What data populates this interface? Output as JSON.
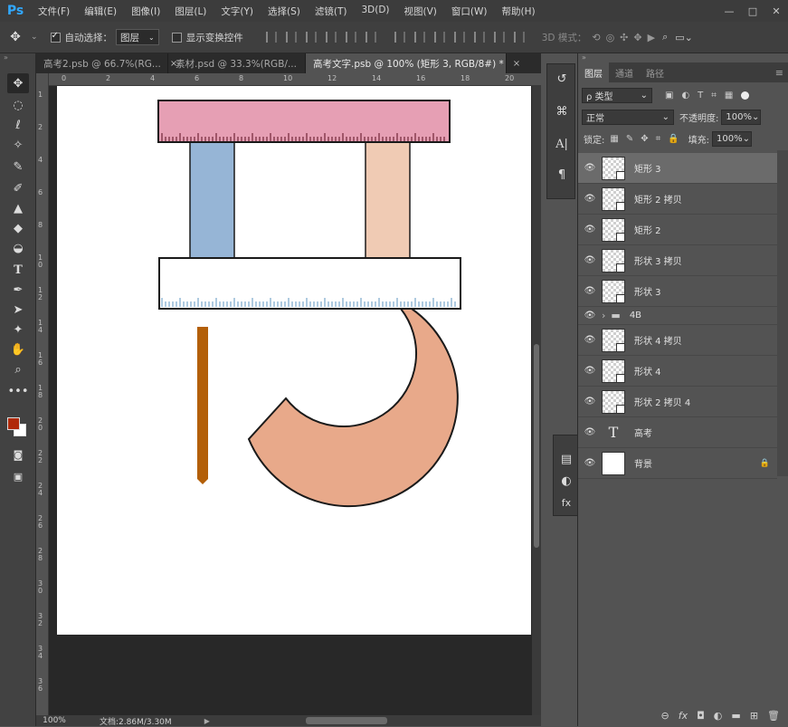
{
  "app": {
    "logo": "Ps"
  },
  "menu": [
    "文件(F)",
    "编辑(E)",
    "图像(I)",
    "图层(L)",
    "文字(Y)",
    "选择(S)",
    "滤镜(T)",
    "3D(D)",
    "视图(V)",
    "窗口(W)",
    "帮助(H)"
  ],
  "window_controls": {
    "minimize": "—",
    "maximize": "□",
    "close": "✕"
  },
  "options": {
    "auto_select_label": "自动选择：",
    "auto_select_value": "图层",
    "show_transform_label": "显示变换控件",
    "mode_3d_label": "3D 模式："
  },
  "tabs": [
    {
      "label": "高考2.psb @ 66.7%(RG...",
      "close": "×"
    },
    {
      "label": "素材.psd @ 33.3%(RGB/...",
      "close": "×"
    },
    {
      "label": "高考文字.psb @ 100% (矩形 3, RGB/8#) *",
      "close": "×"
    }
  ],
  "ruler": {
    "top": [
      "0",
      "2",
      "4",
      "6",
      "8",
      "10",
      "12",
      "14",
      "16",
      "18",
      "20"
    ],
    "left": [
      "1",
      "2",
      "4",
      "6",
      "8",
      "1\n0",
      "1\n2",
      "1\n4",
      "1\n6",
      "1\n8",
      "2\n0",
      "2\n2",
      "2\n4",
      "2\n6",
      "2\n8",
      "3\n0",
      "3\n2",
      "3\n4",
      "3\n6"
    ]
  },
  "status": {
    "zoom": "100%",
    "doc_info": "文档:2.86M/3.30M"
  },
  "colors": {
    "pink_bar": "#e69fb4",
    "blue_bar": "#96b5d6",
    "peach_bar": "#f0cbb4",
    "arc": "#e8a98a",
    "orange_stick": "#b35f08",
    "ruler_tick_blue": "#8cb4d2",
    "ruler_tick_dark": "#5a0e1e"
  },
  "panel": {
    "tabs": [
      "图层",
      "通道",
      "路径"
    ],
    "filter_label": "ρ 类型",
    "blend_mode": "正常",
    "opacity_label": "不透明度:",
    "opacity_value": "100%",
    "lock_label": "锁定:",
    "fill_label": "填充:",
    "fill_value": "100%",
    "layers": [
      {
        "name": "矩形 3",
        "type": "shape",
        "selected": true
      },
      {
        "name": "矩形 2 拷贝",
        "type": "shape",
        "selected": false
      },
      {
        "name": "矩形 2",
        "type": "shape",
        "selected": false
      },
      {
        "name": "形状 3 拷贝",
        "type": "shape",
        "selected": false
      },
      {
        "name": "形状 3",
        "type": "shape",
        "selected": false
      },
      {
        "name": "4B",
        "type": "group",
        "selected": false
      },
      {
        "name": "形状 4 拷贝",
        "type": "shape",
        "selected": false
      },
      {
        "name": "形状 4",
        "type": "shape",
        "selected": false
      },
      {
        "name": "形状 2 拷贝 4",
        "type": "shape",
        "selected": false
      },
      {
        "name": "高考",
        "type": "text",
        "selected": false
      },
      {
        "name": "背景",
        "type": "background",
        "selected": false
      }
    ],
    "bottom_icons": [
      "link-icon",
      "fx-icon",
      "mask-icon",
      "adjustment-icon",
      "folder-icon",
      "new-layer-icon",
      "trash-icon"
    ]
  }
}
